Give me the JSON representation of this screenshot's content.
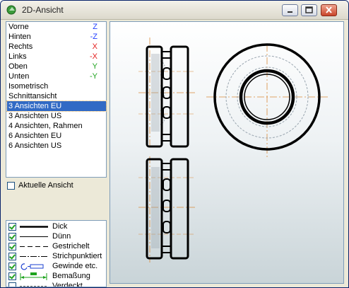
{
  "window": {
    "title": "2D-Ansicht"
  },
  "views": [
    {
      "label": "Vorne",
      "key": "Z",
      "key_color": "#1e3cff"
    },
    {
      "label": "Hinten",
      "key": "-Z",
      "key_color": "#1e3cff"
    },
    {
      "label": "Rechts",
      "key": "X",
      "key_color": "#e41e1e"
    },
    {
      "label": "Links",
      "key": "-X",
      "key_color": "#e41e1e"
    },
    {
      "label": "Oben",
      "key": "Y",
      "key_color": "#1ea31e"
    },
    {
      "label": "Unten",
      "key": "-Y",
      "key_color": "#1ea31e"
    },
    {
      "label": "Isometrisch",
      "key": ""
    },
    {
      "label": "Schnittansicht",
      "key": ""
    },
    {
      "label": "3 Ansichten EU",
      "key": "",
      "selected": true
    },
    {
      "label": "3 Ansichten US",
      "key": ""
    },
    {
      "label": "4 Ansichten, Rahmen",
      "key": ""
    },
    {
      "label": "6 Ansichten EU",
      "key": ""
    },
    {
      "label": "6 Ansichten US",
      "key": ""
    }
  ],
  "current_view": {
    "label": "Aktuelle Ansicht",
    "checked": false
  },
  "line_types": [
    {
      "label": "Dick",
      "checked": true,
      "icon": "thick-line-icon"
    },
    {
      "label": "Dünn",
      "checked": true,
      "icon": "thin-line-icon"
    },
    {
      "label": "Gestrichelt",
      "checked": true,
      "icon": "dashed-line-icon"
    },
    {
      "label": "Strichpunktiert",
      "checked": true,
      "icon": "dash-dot-line-icon"
    },
    {
      "label": "Gewinde etc.",
      "checked": true,
      "icon": "thread-icon"
    },
    {
      "label": "Bemaßung",
      "checked": true,
      "icon": "dimension-icon"
    },
    {
      "label": "Verdeckt",
      "checked": false,
      "icon": "hidden-line-icon"
    }
  ],
  "colors": {
    "selection": "#316ac5",
    "centerline": "#d98a3a",
    "hidden": "#9aa6b0"
  }
}
